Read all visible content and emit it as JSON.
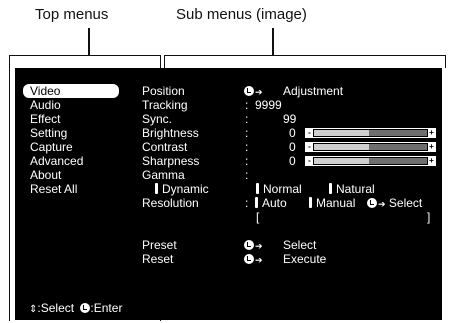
{
  "callouts": {
    "top_menus": "Top menus",
    "sub_menus": "Sub menus (image)"
  },
  "top_menu": [
    "Video",
    "Audio",
    "Effect",
    "Setting",
    "Capture",
    "Advanced",
    "About",
    "Reset All"
  ],
  "sub": {
    "position": {
      "label": "Position",
      "value": "Adjustment"
    },
    "tracking": {
      "label": "Tracking",
      "value": "9999"
    },
    "sync": {
      "label": "Sync.",
      "value": "99"
    },
    "brightness": {
      "label": "Brightness",
      "value": "0"
    },
    "contrast": {
      "label": "Contrast",
      "value": "0"
    },
    "sharpness": {
      "label": "Sharpness",
      "value": "0"
    },
    "gamma": {
      "label": "Gamma",
      "dynamic": "Dynamic",
      "normal": "Normal",
      "natural": "Natural"
    },
    "resolution": {
      "label": "Resolution",
      "auto": "Auto",
      "manual": "Manual",
      "select": "Select",
      "bracket_open": "[",
      "bracket_close": "]"
    },
    "preset": {
      "label": "Preset",
      "value": "Select"
    },
    "reset": {
      "label": "Reset",
      "value": "Execute"
    },
    "colon": ":"
  },
  "footer": {
    "select": ":Select",
    "enter": ":Enter"
  }
}
